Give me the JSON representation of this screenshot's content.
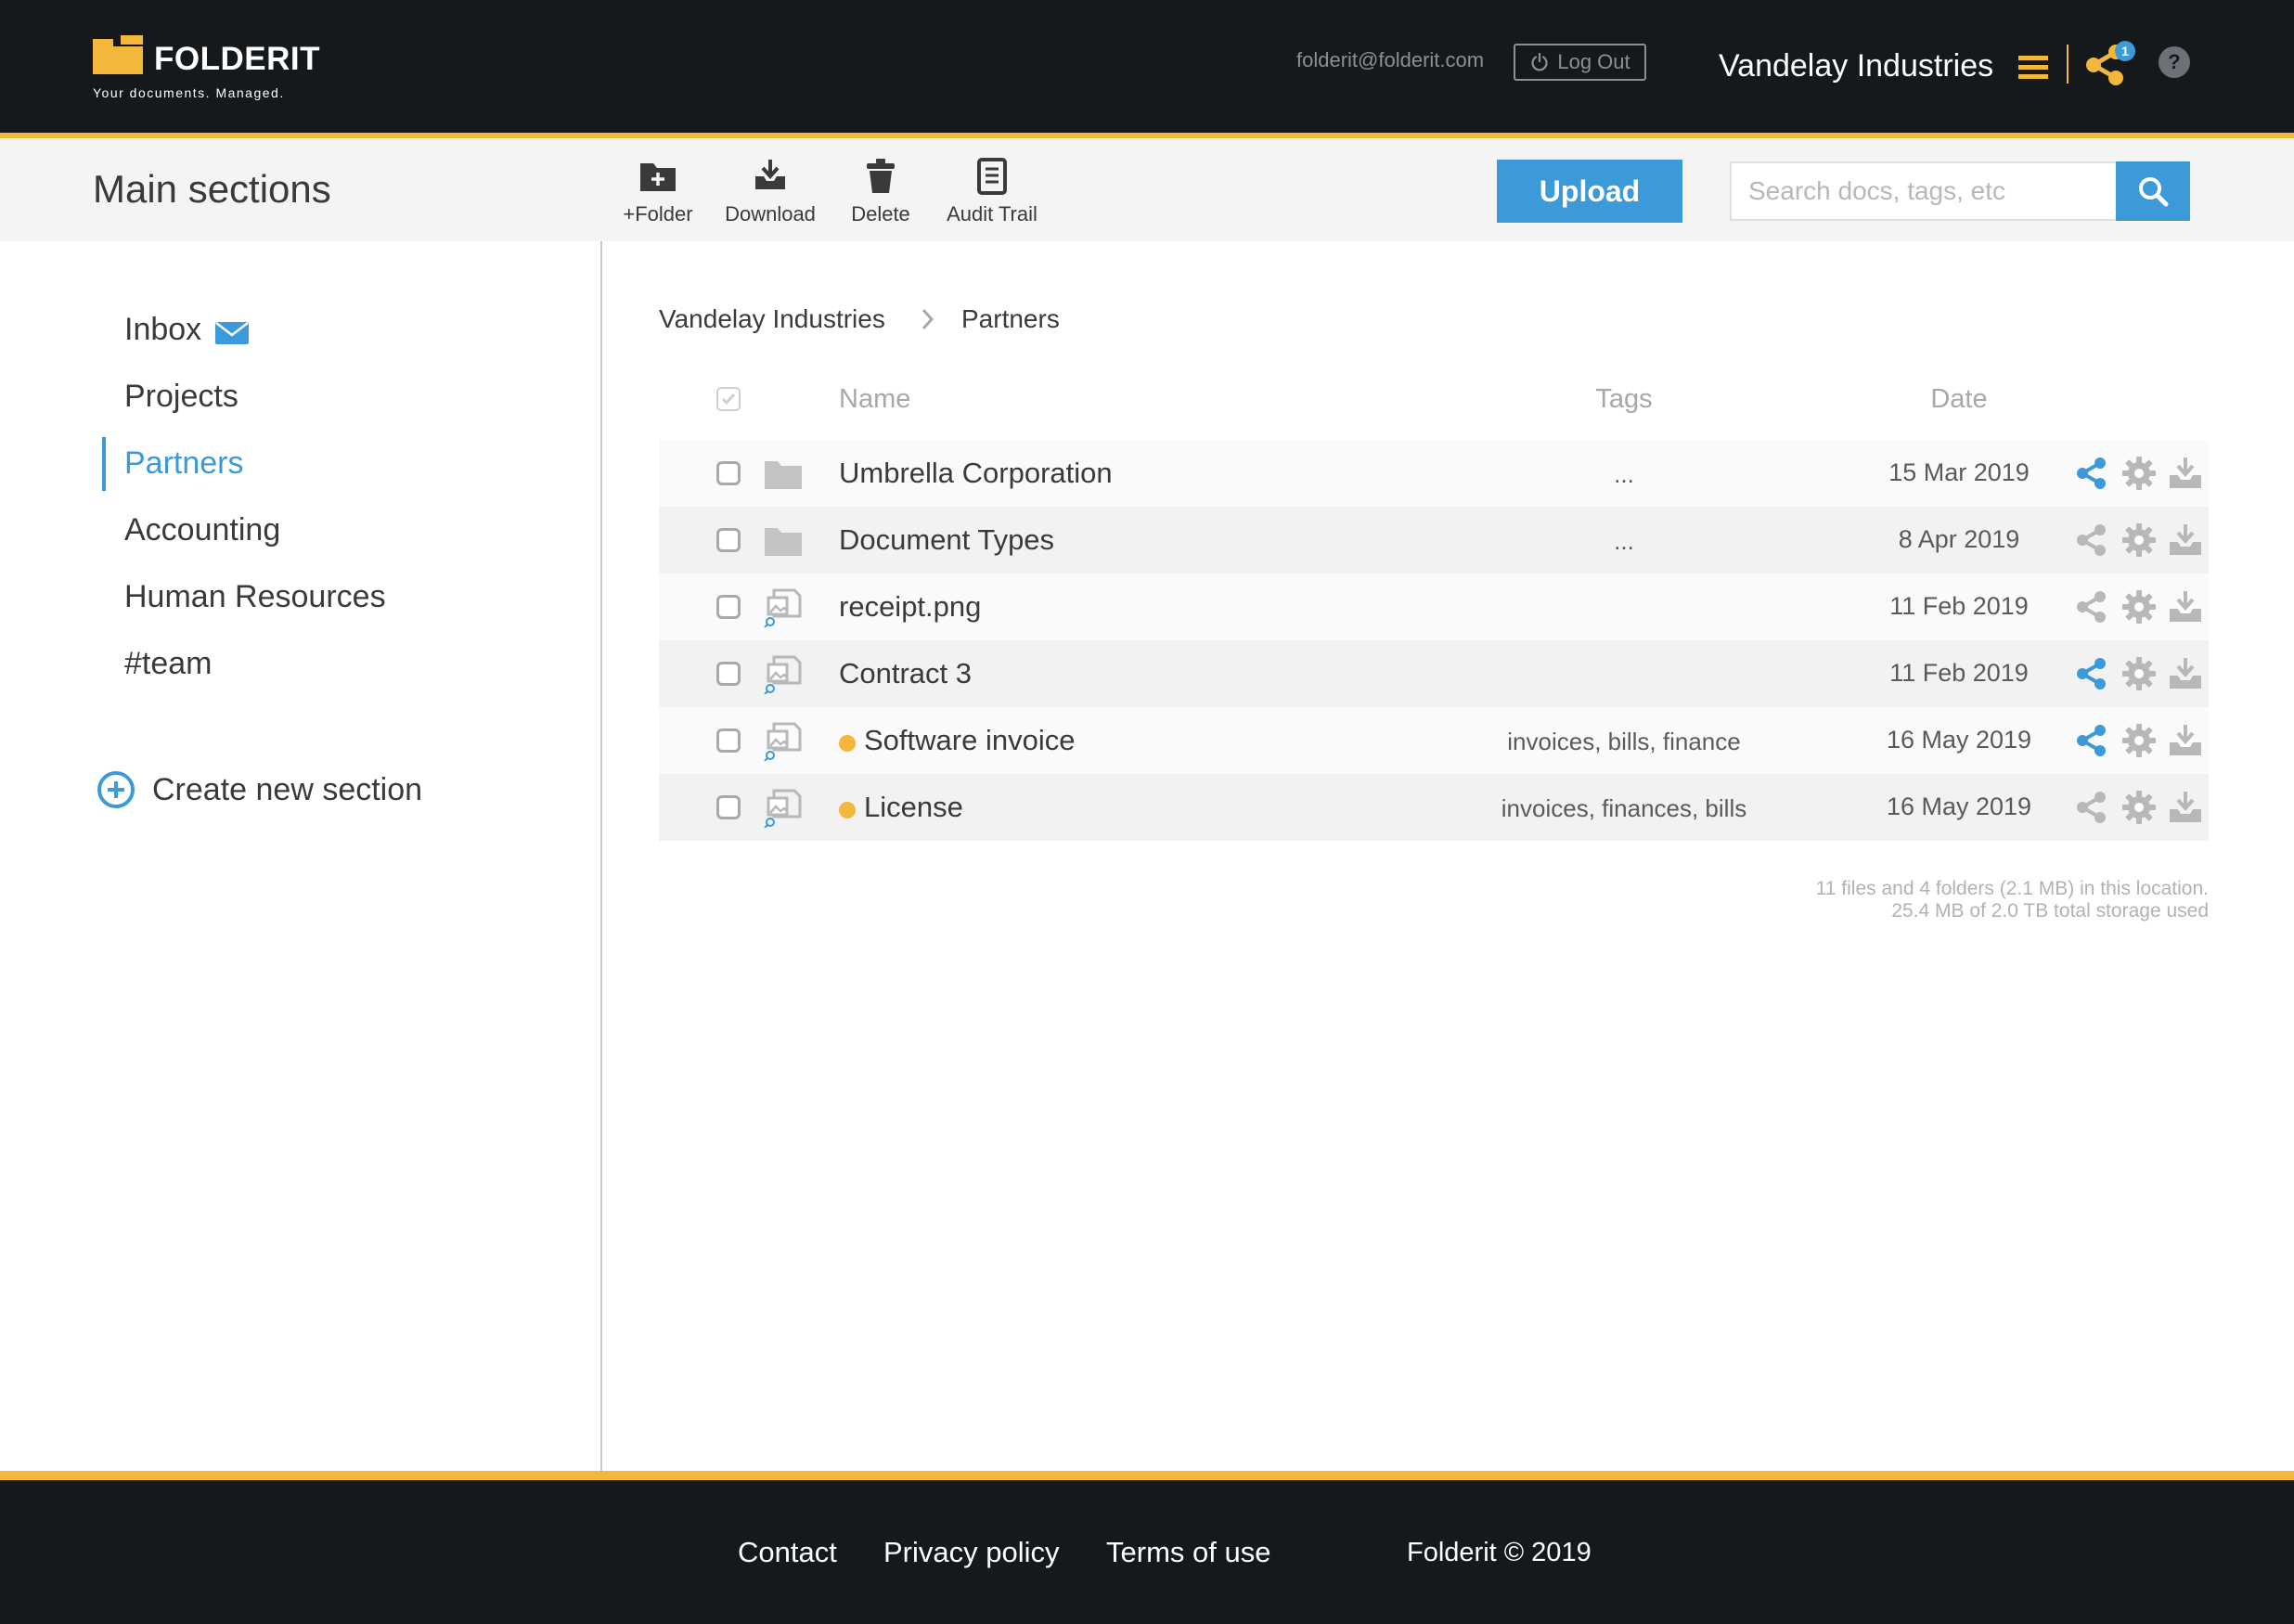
{
  "brand": {
    "name": "FOLDERIT",
    "tagline": "Your documents. Managed.",
    "accent_color": "#f2b73b",
    "primary_color": "#3d9ad8"
  },
  "header": {
    "user_email": "folderit@folderit.com",
    "logout_label": "Log Out",
    "company": "Vandelay Industries",
    "share_badge_count": "1",
    "help_label": "?"
  },
  "toolbar": {
    "section_title": "Main sections",
    "tools": [
      {
        "label": "+Folder",
        "icon": "add-folder-icon"
      },
      {
        "label": "Download",
        "icon": "download-icon"
      },
      {
        "label": "Delete",
        "icon": "trash-icon"
      },
      {
        "label": "Audit Trail",
        "icon": "audit-document-icon"
      }
    ],
    "upload_label": "Upload",
    "search_placeholder": "Search docs, tags, etc",
    "search_value": ""
  },
  "sidebar": {
    "items": [
      {
        "label": "Inbox",
        "icon": "envelope-icon",
        "active": false
      },
      {
        "label": "Projects",
        "active": false
      },
      {
        "label": "Partners",
        "active": true
      },
      {
        "label": "Accounting",
        "active": false
      },
      {
        "label": "Human Resources",
        "active": false
      },
      {
        "label": "#team",
        "active": false
      }
    ],
    "create_label": "Create new section"
  },
  "breadcrumb": [
    "Vandelay Industries",
    "Partners"
  ],
  "table": {
    "headers": {
      "name": "Name",
      "tags": "Tags",
      "date": "Date"
    },
    "rows": [
      {
        "type": "folder",
        "name": "Umbrella Corporation",
        "tags": "...",
        "date": "15 Mar 2019",
        "shared": true,
        "flagged": false
      },
      {
        "type": "folder",
        "name": "Document Types",
        "tags": "...",
        "date": "8 Apr 2019",
        "shared": false,
        "flagged": false
      },
      {
        "type": "file",
        "name": "receipt.png",
        "tags": "",
        "date": "11 Feb 2019",
        "shared": false,
        "flagged": false
      },
      {
        "type": "file",
        "name": "Contract 3",
        "tags": "",
        "date": "11 Feb 2019",
        "shared": true,
        "flagged": false
      },
      {
        "type": "file",
        "name": "Software invoice",
        "tags": "invoices, bills, finance",
        "date": "16 May 2019",
        "shared": true,
        "flagged": true
      },
      {
        "type": "file",
        "name": "License",
        "tags": "invoices, finances, bills",
        "date": "16 May 2019",
        "shared": false,
        "flagged": true
      }
    ]
  },
  "storage": {
    "line1": "11 files and 4 folders (2.1 MB) in this location.",
    "line2": "25.4 MB of 2.0 TB total storage used"
  },
  "footer": {
    "links": [
      "Contact",
      "Privacy policy",
      "Terms of use"
    ],
    "copyright": "Folderit © 2019"
  }
}
